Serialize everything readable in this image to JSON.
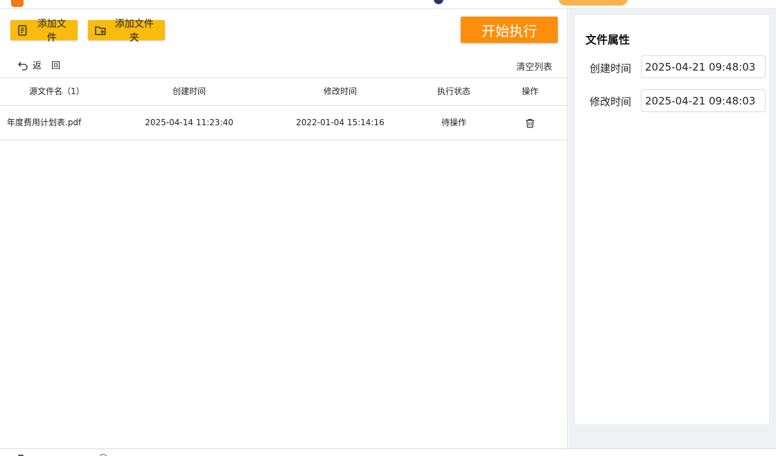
{
  "toolbar": {
    "add_file_label": "添加文件",
    "add_folder_label": "添加文件夹",
    "start_label": "开始执行",
    "back_label": "返回",
    "clear_label": "清空列表"
  },
  "table": {
    "headers": [
      "源文件名（1）",
      "创建时间",
      "修改时间",
      "执行状态",
      "操作"
    ],
    "rows": [
      {
        "filename": "年度费用计划表.pdf",
        "created": "2025-04-14 11:23:40",
        "modified": "2022-01-04 15:14:16",
        "status": "待操作",
        "action_icon": "trash-icon"
      }
    ]
  },
  "side_panel": {
    "title": "文件属性",
    "created_label": "创建时间",
    "created_value": "2025-04-21 09:48:03",
    "modified_label": "修改时间",
    "modified_value": "2025-04-21 09:48:03"
  },
  "colors": {
    "accent_yellow": "#f9bb0d",
    "accent_orange": "#fb8f0c",
    "panel_bg": "#f0f1f4"
  },
  "icons": [
    "file-list-icon",
    "folder-add-icon",
    "undo-arrow-icon",
    "trash-icon"
  ]
}
